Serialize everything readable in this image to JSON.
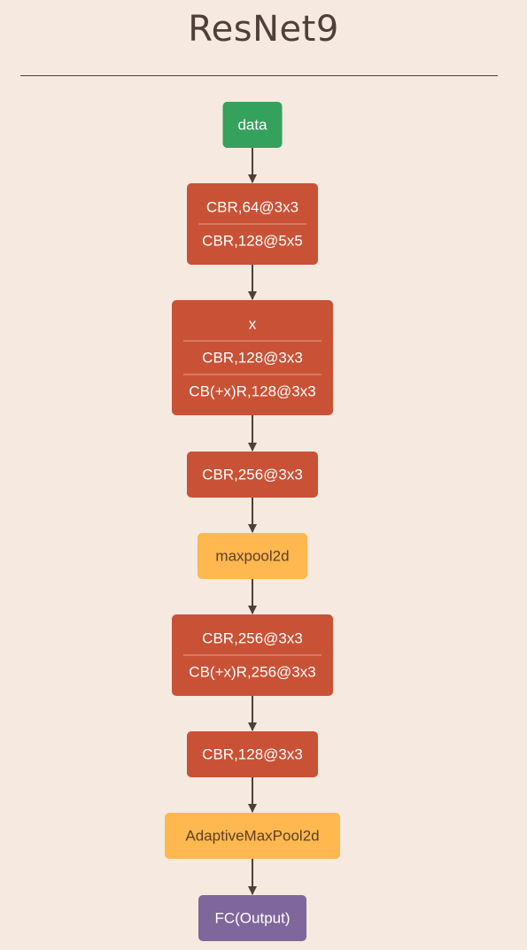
{
  "title": "ResNet9",
  "colors": {
    "background": "#f5e9e0",
    "text_dark": "#4e3f38",
    "edge": "#4e3f38",
    "data": "#34a15c",
    "conv": "#c95236",
    "pool": "#ffb84f",
    "output": "#7f679c",
    "text_light": "#ffffff",
    "text_on_pool": "#5b3f2a"
  },
  "nodes": [
    {
      "id": "data",
      "kind": "data",
      "rows": [
        "data"
      ]
    },
    {
      "id": "prep",
      "kind": "conv",
      "rows": [
        "CBR,64@3x3",
        "CBR,128@5x5"
      ]
    },
    {
      "id": "res1",
      "kind": "conv",
      "rows": [
        "x",
        "CBR,128@3x3",
        "CB(+x)R,128@3x3"
      ]
    },
    {
      "id": "layer2",
      "kind": "conv",
      "rows": [
        "CBR,256@3x3"
      ]
    },
    {
      "id": "pool1",
      "kind": "pool",
      "rows": [
        "maxpool2d"
      ]
    },
    {
      "id": "res2",
      "kind": "conv",
      "rows": [
        "CBR,256@3x3",
        "CB(+x)R,256@3x3"
      ]
    },
    {
      "id": "layer3",
      "kind": "conv",
      "rows": [
        "CBR,128@3x3"
      ]
    },
    {
      "id": "pool2",
      "kind": "pool",
      "rows": [
        "AdaptiveMaxPool2d"
      ]
    },
    {
      "id": "output",
      "kind": "output",
      "rows": [
        "FC(Output)"
      ]
    }
  ],
  "edges": [
    [
      "data",
      "prep"
    ],
    [
      "prep",
      "res1"
    ],
    [
      "res1",
      "layer2"
    ],
    [
      "layer2",
      "pool1"
    ],
    [
      "pool1",
      "res2"
    ],
    [
      "res2",
      "layer3"
    ],
    [
      "layer3",
      "pool2"
    ],
    [
      "pool2",
      "output"
    ]
  ]
}
